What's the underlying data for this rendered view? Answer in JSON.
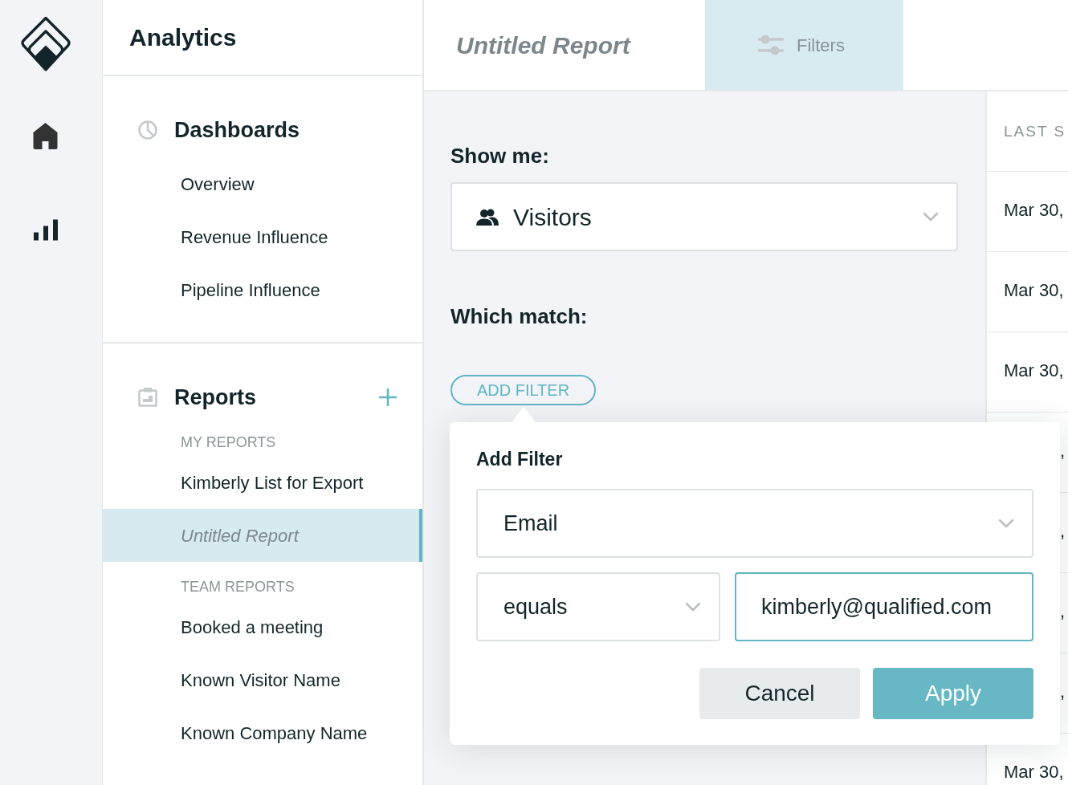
{
  "sidebar": {
    "title": "Analytics",
    "sections": [
      {
        "title": "Dashboards",
        "add_button": false,
        "groups": [
          {
            "items": [
              {
                "label": "Overview",
                "selected": false,
                "draft": false
              },
              {
                "label": "Revenue Influence",
                "selected": false,
                "draft": false
              },
              {
                "label": "Pipeline Influence",
                "selected": false,
                "draft": false
              }
            ]
          }
        ]
      },
      {
        "title": "Reports",
        "add_button": true,
        "groups": [
          {
            "heading": "MY REPORTS",
            "items": [
              {
                "label": "Kimberly List for Export",
                "selected": false,
                "draft": false
              },
              {
                "label": "Untitled Report",
                "selected": true,
                "draft": true
              }
            ]
          },
          {
            "heading": "TEAM REPORTS",
            "items": [
              {
                "label": "Booked a meeting",
                "selected": false,
                "draft": false
              },
              {
                "label": "Known Visitor Name",
                "selected": false,
                "draft": false
              },
              {
                "label": "Known Company Name",
                "selected": false,
                "draft": false
              }
            ]
          }
        ]
      }
    ]
  },
  "report": {
    "title": "Untitled Report",
    "draft": true,
    "tabs": [
      {
        "label": "Filters",
        "selected": true
      }
    ]
  },
  "filters": {
    "show_me_label": "Show me:",
    "show_me": {
      "value": "Visitors"
    },
    "match_label": "Which match:",
    "add_button": "ADD FILTER"
  },
  "add_filter_popover": {
    "title": "Add Filter",
    "field": {
      "value": "Email"
    },
    "operator": {
      "value": "equals"
    },
    "value_input": {
      "value": "kimberly@qualified.com",
      "focused": true
    },
    "buttons": [
      {
        "label": "Cancel",
        "kind": "secondary"
      },
      {
        "label": "Apply",
        "kind": "primary"
      }
    ]
  },
  "table": {
    "column_1": "LAST S",
    "rows": [
      {
        "text": "Mar 30,",
        "covered": false
      },
      {
        "text": "Mar 30,",
        "covered": false
      },
      {
        "text": "Mar 30,",
        "covered": false
      },
      {
        "text": ",",
        "covered": true
      },
      {
        "text": ",",
        "covered": true
      },
      {
        "text": ",",
        "covered": true
      },
      {
        "text": ",",
        "covered": true
      },
      {
        "text": "Mar 30,",
        "covered": false
      }
    ]
  }
}
